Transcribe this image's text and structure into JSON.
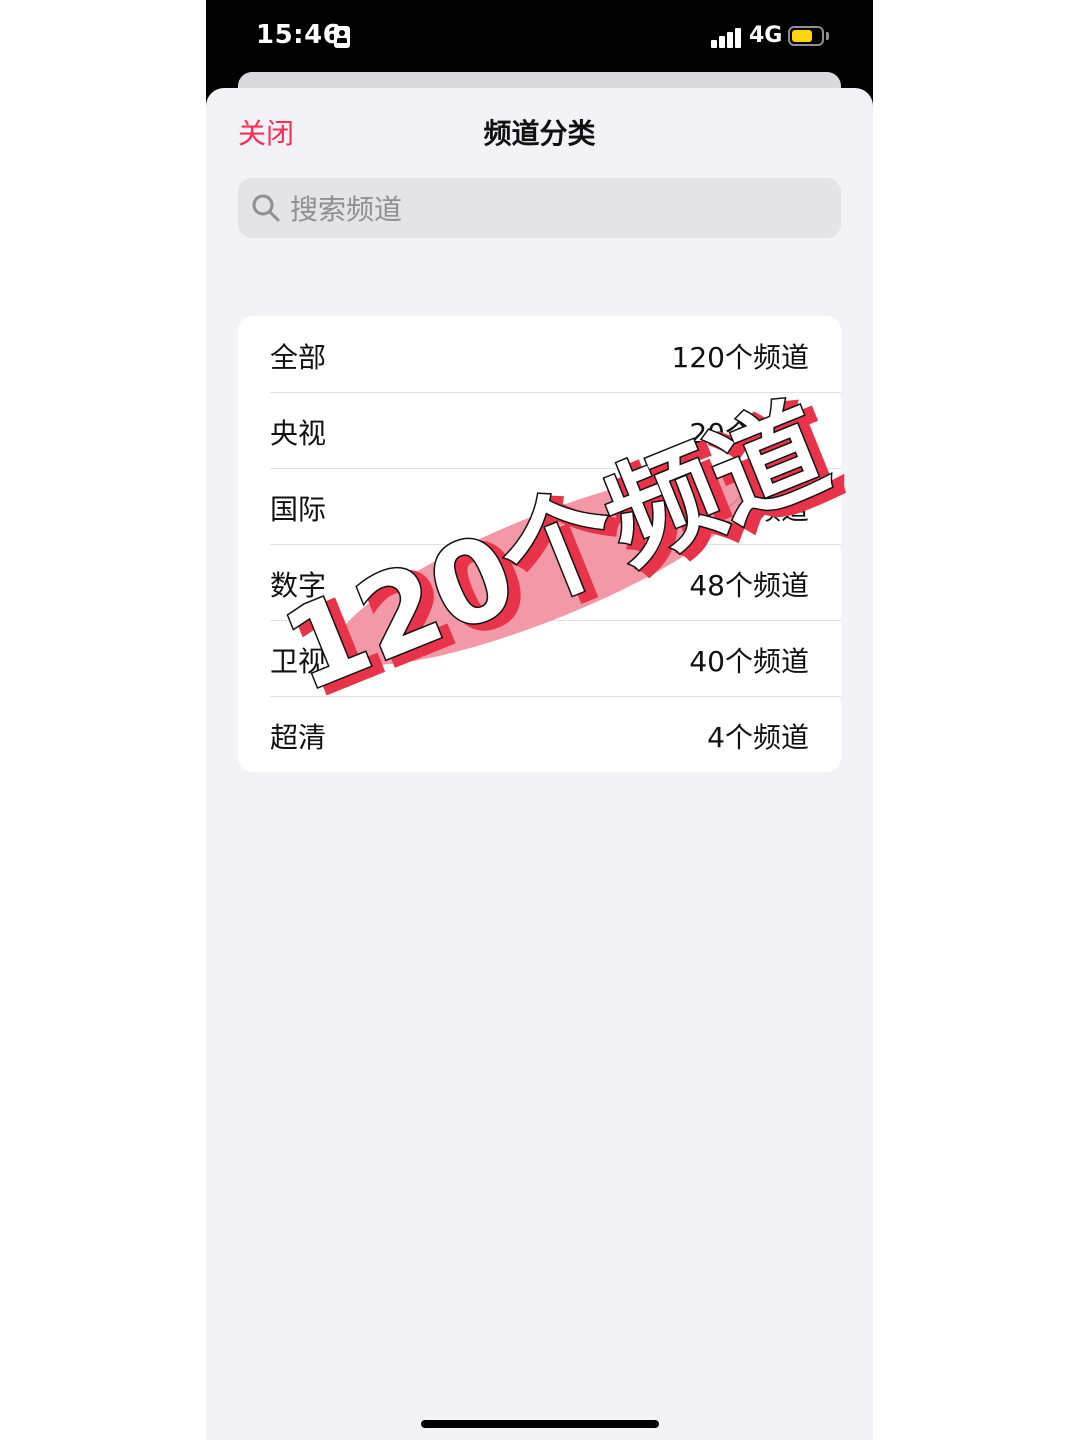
{
  "status_bar": {
    "time": "15:46",
    "network": "4G",
    "battery_level": 0.7,
    "battery_color": "#ffd60a"
  },
  "header": {
    "close_label": "关闭",
    "title": "频道分类",
    "accent_color": "#ff2d55"
  },
  "search": {
    "placeholder": "搜索频道",
    "value": ""
  },
  "categories": [
    {
      "name": "全部",
      "count": "120个频道"
    },
    {
      "name": "央视",
      "count": "20个频道"
    },
    {
      "name": "国际",
      "count": "8个频道"
    },
    {
      "name": "数字",
      "count": "48个频道"
    },
    {
      "name": "卫视",
      "count": "40个频道"
    },
    {
      "name": "超清",
      "count": "4个频道"
    }
  ],
  "overlay": {
    "caption": "120个频道",
    "highlight_color": "#f28fa0",
    "shadow_color": "#e8334a"
  }
}
